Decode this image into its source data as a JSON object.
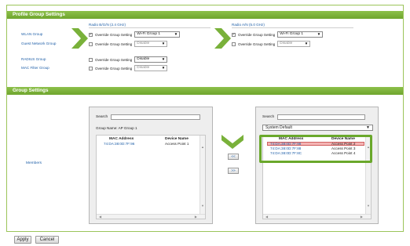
{
  "profile_group": {
    "title": "Profile Group Settings",
    "radio_bgn_label": "Radio B/G/N (2.4 GHz)",
    "radio_an_label": "Radio A/N (5.0 GHz)",
    "rows": [
      {
        "label": "WLAN Group",
        "bgn": {
          "checked": true,
          "text": "Override Group Setting",
          "select": "Wi-Fi Group 1",
          "disabled": false
        },
        "an": {
          "checked": true,
          "text": "Override Group Setting",
          "select": "Wi-Fi Group 1",
          "disabled": false
        }
      },
      {
        "label": "Guest Network Group",
        "bgn": {
          "checked": false,
          "text": "Override Group Setting",
          "select": "Disable",
          "disabled": true
        },
        "an": {
          "checked": false,
          "text": "Override Group Setting",
          "select": "Disable",
          "disabled": true
        }
      },
      {
        "label": "RADIUS Group",
        "bgn": {
          "checked": false,
          "text": "Override Group Setting",
          "select": "Disable",
          "disabled": false
        }
      },
      {
        "label": "MAC Filter Group",
        "bgn": {
          "checked": false,
          "text": "Override Group Setting",
          "select": "Disable",
          "disabled": true
        }
      }
    ]
  },
  "group_settings": {
    "title": "Group Settings",
    "members_label": "Members",
    "left_panel": {
      "search_label": "Search",
      "group_name": "Group Name: AP Group 1",
      "col_mac": "MAC Address",
      "col_device": "Device Name",
      "rows": [
        {
          "mac": "74:DA:38:0D:7F:96",
          "device": "Access Point 1"
        }
      ]
    },
    "move_left_label": "<<",
    "move_right_label": ">>",
    "right_panel": {
      "search_label": "Search",
      "select_value": "System Default",
      "col_mac": "MAC Address",
      "col_device": "Device Name",
      "rows": [
        {
          "mac": "74:DA:38:0D:7F:98",
          "device": "Access Point 2",
          "selected": true
        },
        {
          "mac": "74:DA:38:0D:7F:88",
          "device": "Access Point 3",
          "selected": false
        },
        {
          "mac": "74:DA:38:0D:7F:8C",
          "device": "Access Point 4",
          "selected": false
        }
      ]
    }
  },
  "footer": {
    "apply_label": "Apply",
    "cancel_label": "Cancel"
  },
  "colors": {
    "accent_green": "#6aa82b",
    "link_blue": "#1f5fa8",
    "highlight_red": "#f4b4b4"
  }
}
